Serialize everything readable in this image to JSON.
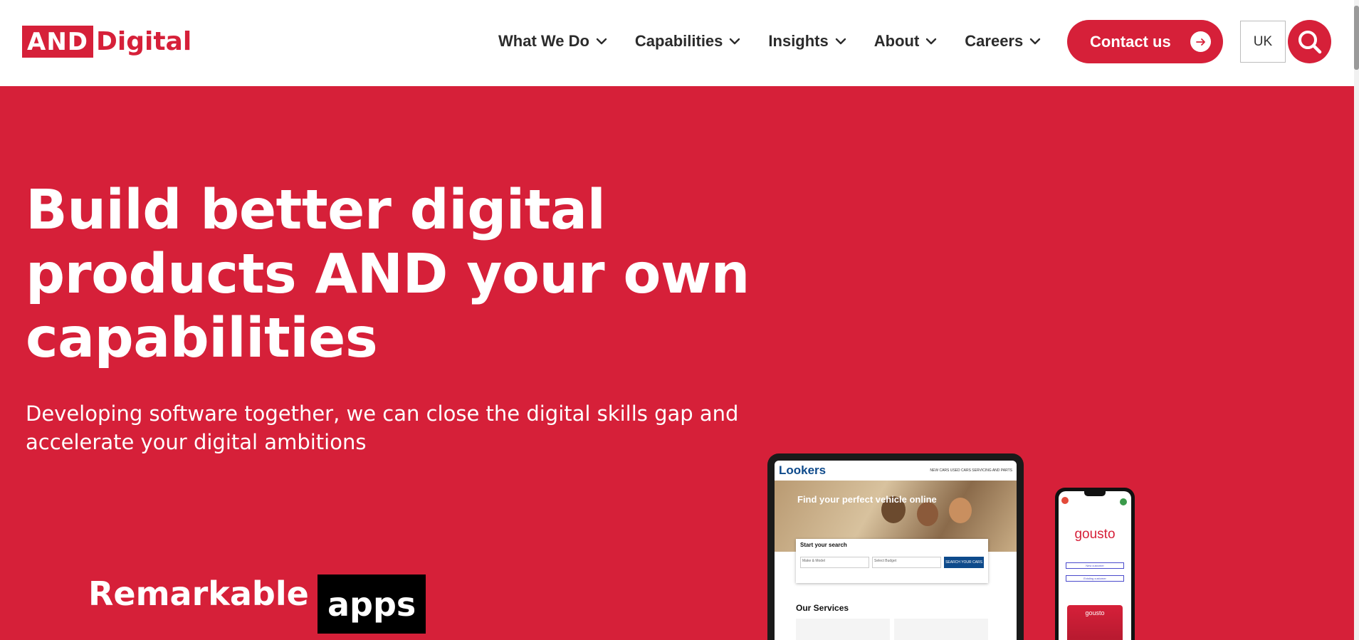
{
  "header": {
    "logo_box": "AND",
    "logo_text": "Digital",
    "nav": [
      {
        "label": "What We Do"
      },
      {
        "label": "Capabilities"
      },
      {
        "label": "Insights"
      },
      {
        "label": "About"
      },
      {
        "label": "Careers"
      }
    ],
    "contact_label": "Contact us",
    "region_label": "UK"
  },
  "hero": {
    "title": "Build better digital products AND your own capabilities",
    "subtitle": "Developing software together, we can close the digital skills gap and accelerate your digital ambitions",
    "remark_word": "Remarkable",
    "remark_highlight": "apps"
  },
  "mockups": {
    "tablet": {
      "logo": "Lookers",
      "nav_links": "NEW CARS   USED CARS   SERVICING AND PARTS",
      "hero_text": "Find your perfect vehicle online",
      "card_title": "Start your search",
      "field_1": "Make & Model",
      "field_2": "Select Budget",
      "search_btn": "SEARCH YOUR CARS",
      "services_title": "Our Services"
    },
    "phone": {
      "brand": "gousto",
      "btn_1": "New customer",
      "btn_2": "Existing customer",
      "box_label": "gousto"
    }
  },
  "colors": {
    "brand_red": "#d62039",
    "text_dark": "#2b2b2b",
    "white": "#ffffff"
  }
}
